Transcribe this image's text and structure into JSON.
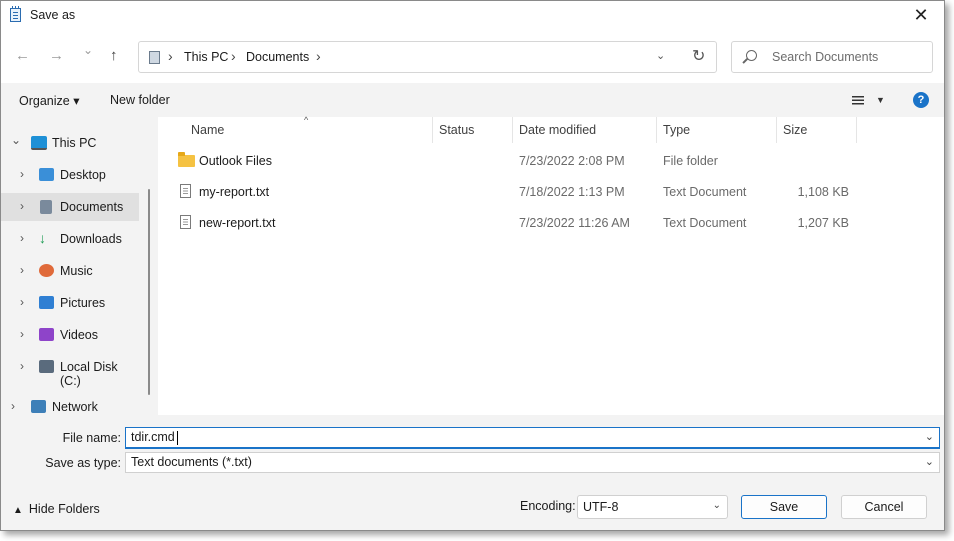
{
  "window": {
    "title": "Save as",
    "close_glyph": "✕"
  },
  "nav": {
    "back_glyph": "←",
    "forward_glyph": "→",
    "history_glyph": "⌄",
    "up_glyph": "↑",
    "breadcrumb": [
      "This PC",
      "Documents"
    ],
    "sep_glyph": "›",
    "dropdown_glyph": "⌄",
    "refresh_glyph": "↻",
    "search_placeholder": "Search Documents"
  },
  "commandbar": {
    "organize": "Organize ▾",
    "new_folder": "New folder",
    "view_dropdown": "▼",
    "help": "?"
  },
  "sidebar": {
    "items": [
      {
        "label": "This PC",
        "chevron": "⌄",
        "icon": "pc-icon"
      },
      {
        "label": "Desktop",
        "chevron": "›",
        "icon": "desktop-icon"
      },
      {
        "label": "Documents",
        "chevron": "›",
        "icon": "documents-icon"
      },
      {
        "label": "Downloads",
        "chevron": "›",
        "icon": "download-icon"
      },
      {
        "label": "Music",
        "chevron": "›",
        "icon": "music-icon"
      },
      {
        "label": "Pictures",
        "chevron": "›",
        "icon": "pictures-icon"
      },
      {
        "label": "Videos",
        "chevron": "›",
        "icon": "videos-icon"
      },
      {
        "label": "Local Disk (C:)",
        "chevron": "›",
        "icon": "disk-icon"
      },
      {
        "label": "Network",
        "chevron": "›",
        "icon": "network-icon"
      }
    ]
  },
  "files": {
    "columns": [
      "Name",
      "Status",
      "Date modified",
      "Type",
      "Size"
    ],
    "sort_glyph": "^",
    "rows": [
      {
        "name": "Outlook Files",
        "status": "",
        "date": "7/23/2022 2:08 PM",
        "type": "File folder",
        "size": ""
      },
      {
        "name": "my-report.txt",
        "status": "",
        "date": "7/18/2022 1:13 PM",
        "type": "Text Document",
        "size": "1,108 KB"
      },
      {
        "name": "new-report.txt",
        "status": "",
        "date": "7/23/2022 11:26 AM",
        "type": "Text Document",
        "size": "1,207 KB"
      }
    ]
  },
  "form": {
    "file_name_label": "File name:",
    "file_name_value": "tdir.cmd",
    "save_type_label": "Save as type:",
    "save_type_value": "Text documents (*.txt)",
    "dropdown_glyph": "⌄",
    "hide_folders": "Hide Folders",
    "hide_folders_arrow": "▲",
    "encoding_label": "Encoding:",
    "encoding_value": "UTF-8",
    "save": "Save",
    "cancel": "Cancel"
  },
  "colors": {
    "accent": "#1a73c8",
    "folder": "#f5c242",
    "selection": "#e0e0e0"
  }
}
